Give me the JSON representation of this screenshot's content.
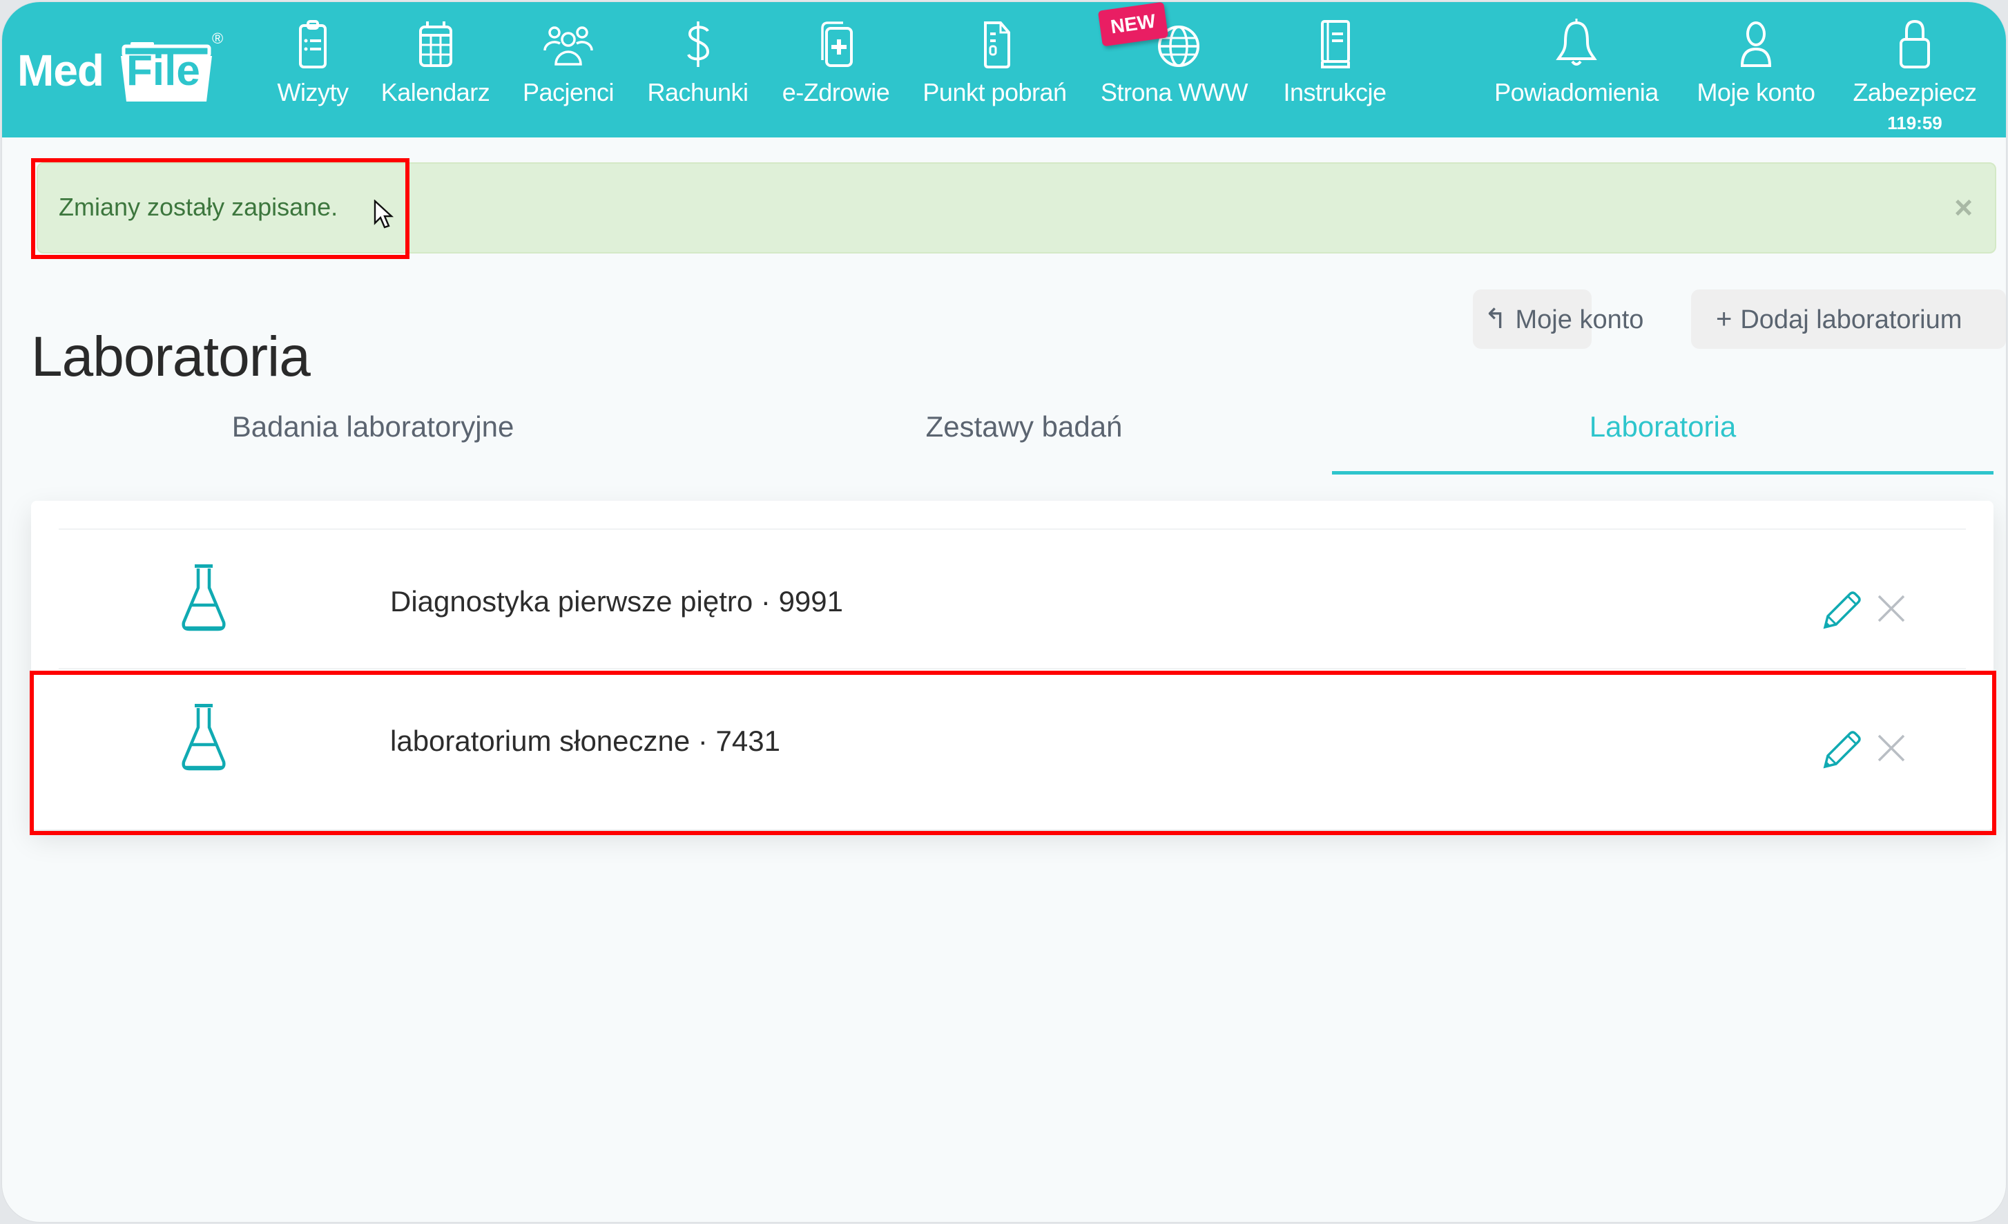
{
  "app": {
    "logo_text_med": "Med",
    "logo_text_file": "File",
    "logo_registered": "®",
    "brand_color": "#2ec5cc"
  },
  "nav": {
    "items": [
      {
        "label": "Wizyty",
        "icon": "clipboard-list-icon"
      },
      {
        "label": "Kalendarz",
        "icon": "calendar-icon"
      },
      {
        "label": "Pacjenci",
        "icon": "users-icon"
      },
      {
        "label": "Rachunki",
        "icon": "dollar-icon"
      },
      {
        "label": "e-Zdrowie",
        "icon": "medical-cards-icon"
      },
      {
        "label": "Punkt pobrań",
        "icon": "document-icon"
      },
      {
        "label": "Strona WWW",
        "icon": "globe-icon",
        "badge": "NEW"
      },
      {
        "label": "Instrukcje",
        "icon": "book-icon"
      }
    ],
    "right_items": [
      {
        "label": "Powiadomienia",
        "icon": "bell-icon"
      },
      {
        "label": "Moje konto",
        "icon": "user-icon"
      },
      {
        "label": "Zabezpiecz",
        "icon": "lock-icon",
        "sub": "119:59"
      }
    ]
  },
  "alert": {
    "message": "Zmiany zostały zapisane.",
    "close_symbol": "×"
  },
  "page": {
    "title": "Laboratoria",
    "back_button": {
      "label": "Moje konto",
      "icon": "↰"
    },
    "add_button": {
      "label": "Dodaj laboratorium",
      "icon": "+"
    }
  },
  "tabs": [
    {
      "label": "Badania laboratoryjne",
      "active": false
    },
    {
      "label": "Zestawy badań",
      "active": false
    },
    {
      "label": "Laboratoria",
      "active": true
    }
  ],
  "labs": [
    {
      "name": "Diagnostyka pierwsze piętro · 9991"
    },
    {
      "name": "laboratorium słoneczne · 7431"
    }
  ]
}
